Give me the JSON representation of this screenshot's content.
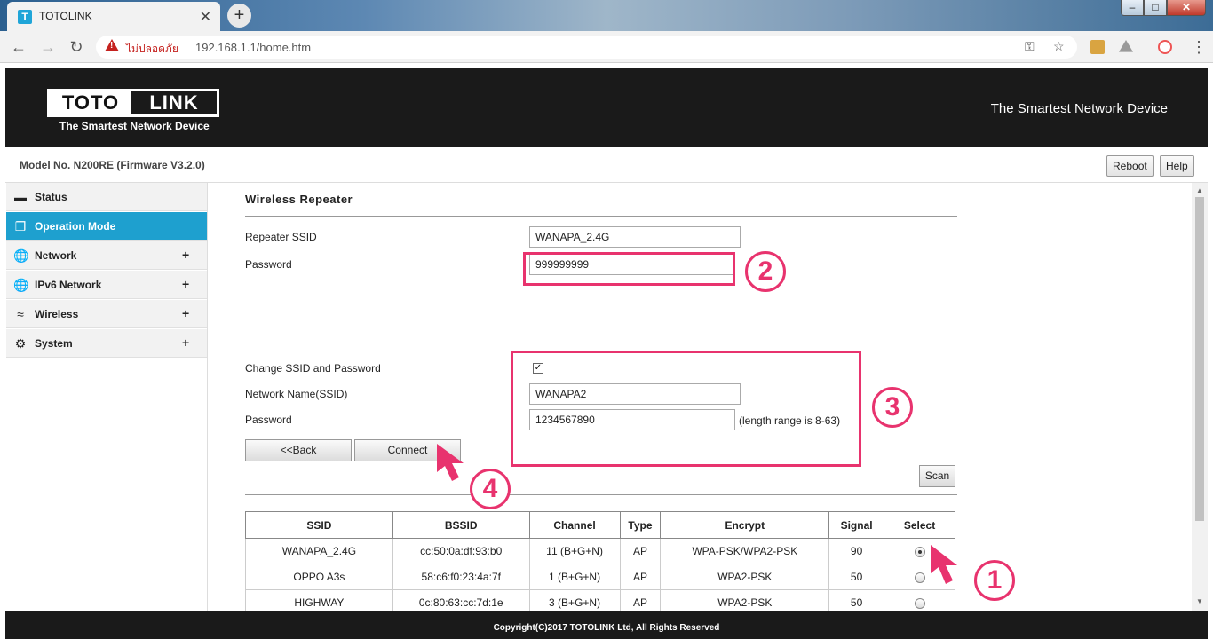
{
  "browser": {
    "tab_title": "TOTOLINK",
    "favicon_letter": "T",
    "tab_close": "✕",
    "new_tab": "+",
    "security_label": "ไม่ปลอดภัย",
    "url": "192.168.1.1/home.htm"
  },
  "header": {
    "logo_left": "TOTO",
    "logo_right": "LINK",
    "logo_tagline": "The Smartest Network Device",
    "slogan": "The Smartest Network Device"
  },
  "modelbar": {
    "model": "Model No. N200RE (Firmware V3.2.0)",
    "reboot": "Reboot",
    "help": "Help"
  },
  "sidebar": {
    "items": [
      {
        "label": "Status",
        "icon": "chat-icon",
        "expand": ""
      },
      {
        "label": "Operation Mode",
        "icon": "window-icon",
        "expand": ""
      },
      {
        "label": "Network",
        "icon": "globe-icon",
        "expand": "+"
      },
      {
        "label": "IPv6 Network",
        "icon": "globe-icon",
        "expand": "+"
      },
      {
        "label": "Wireless",
        "icon": "wifi-icon",
        "expand": "+"
      },
      {
        "label": "System",
        "icon": "gear-icon",
        "expand": "+"
      }
    ]
  },
  "main": {
    "title": "Wireless Repeater",
    "repeater_ssid_label": "Repeater SSID",
    "repeater_ssid_value": "WANAPA_2.4G",
    "password_label": "Password",
    "password_value": "999999999",
    "change_label": "Change SSID and Password",
    "change_checked": true,
    "network_name_label": "Network Name(SSID)",
    "network_name_value": "WANAPA2",
    "password2_label": "Password",
    "password2_value": "1234567890",
    "length_hint": "(length range is 8-63)",
    "back_button": "<<Back",
    "connect_button": "Connect",
    "scan_button": "Scan"
  },
  "callouts": [
    "1",
    "2",
    "3",
    "4"
  ],
  "callout_color": "#e8336e",
  "ap_table": {
    "headers": [
      "SSID",
      "BSSID",
      "Channel",
      "Type",
      "Encrypt",
      "Signal",
      "Select"
    ],
    "rows": [
      {
        "ssid": "WANAPA_2.4G",
        "bssid": "cc:50:0a:df:93:b0",
        "channel": "11 (B+G+N)",
        "type": "AP",
        "encrypt": "WPA-PSK/WPA2-PSK",
        "signal": "90",
        "selected": true
      },
      {
        "ssid": "OPPO A3s",
        "bssid": "58:c6:f0:23:4a:7f",
        "channel": "1 (B+G+N)",
        "type": "AP",
        "encrypt": "WPA2-PSK",
        "signal": "50",
        "selected": false
      },
      {
        "ssid": "HIGHWAY",
        "bssid": "0c:80:63:cc:7d:1e",
        "channel": "3 (B+G+N)",
        "type": "AP",
        "encrypt": "WPA2-PSK",
        "signal": "50",
        "selected": false
      }
    ]
  },
  "footer": "Copyright(C)2017 TOTOLINK Ltd, All Rights Reserved",
  "colors": {
    "accent": "#1ea0cf",
    "header_bg": "#1a1a1a"
  }
}
